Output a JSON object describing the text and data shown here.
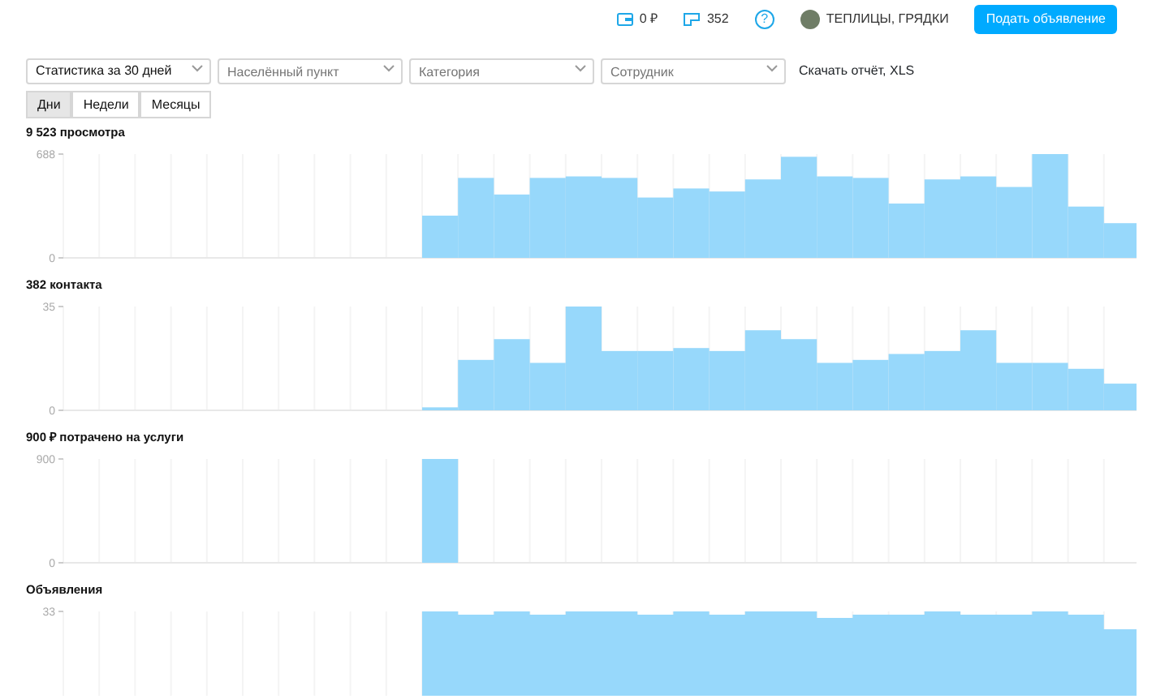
{
  "header": {
    "wallet": "0 ₽",
    "listings_count": "352",
    "help": "?",
    "account_name": "ТЕПЛИЦЫ, ГРЯДКИ",
    "post_button": "Подать объявление"
  },
  "filters": [
    {
      "kind": "value",
      "text": "Статистика за 30 дней"
    },
    {
      "kind": "placeholder",
      "placeholder": "Населённый пункт"
    },
    {
      "kind": "placeholder",
      "placeholder": "Категория"
    },
    {
      "kind": "placeholder",
      "placeholder": "Сотрудник"
    }
  ],
  "download_link": "Скачать отчёт, XLS",
  "periods": [
    {
      "label": "Дни",
      "selected": true
    },
    {
      "label": "Недели",
      "selected": false
    },
    {
      "label": "Месяцы",
      "selected": false
    }
  ],
  "charts": [
    {
      "title": "9 523 просмотра",
      "chart_data": {
        "type": "bar",
        "ylim": [
          0,
          688
        ],
        "yticks": [
          0,
          688
        ],
        "series": [
          {
            "color": "#97d8fb",
            "values": [
              0,
              0,
              0,
              0,
              0,
              0,
              0,
              0,
              0,
              0,
              280,
              530,
              420,
              530,
              540,
              530,
              400,
              460,
              440,
              520,
              670,
              540,
              530,
              360,
              520,
              540,
              470,
              688,
              340,
              230
            ]
          }
        ]
      }
    },
    {
      "title": "382 контакта",
      "chart_data": {
        "type": "bar",
        "ylim": [
          0,
          35
        ],
        "yticks": [
          0,
          35
        ],
        "series": [
          {
            "color": "#97d8fb",
            "values": [
              0,
              0,
              0,
              0,
              0,
              0,
              0,
              0,
              0,
              0,
              1,
              17,
              24,
              16,
              35,
              20,
              20,
              21,
              20,
              27,
              24,
              16,
              17,
              19,
              20,
              27,
              16,
              16,
              14,
              9
            ]
          }
        ]
      }
    },
    {
      "title": "900 ₽ потрачено на услуги",
      "chart_data": {
        "type": "bar",
        "ylim": [
          0,
          900
        ],
        "yticks": [
          0,
          900
        ],
        "series": [
          {
            "color": "#97d8fb",
            "values": [
              0,
              0,
              0,
              0,
              0,
              0,
              0,
              0,
              0,
              0,
              900,
              0,
              0,
              0,
              0,
              0,
              0,
              0,
              0,
              0,
              0,
              0,
              0,
              0,
              0,
              0,
              0,
              0,
              0,
              0
            ]
          }
        ]
      }
    },
    {
      "title": "Объявления",
      "y_tick": "33"
    }
  ]
}
